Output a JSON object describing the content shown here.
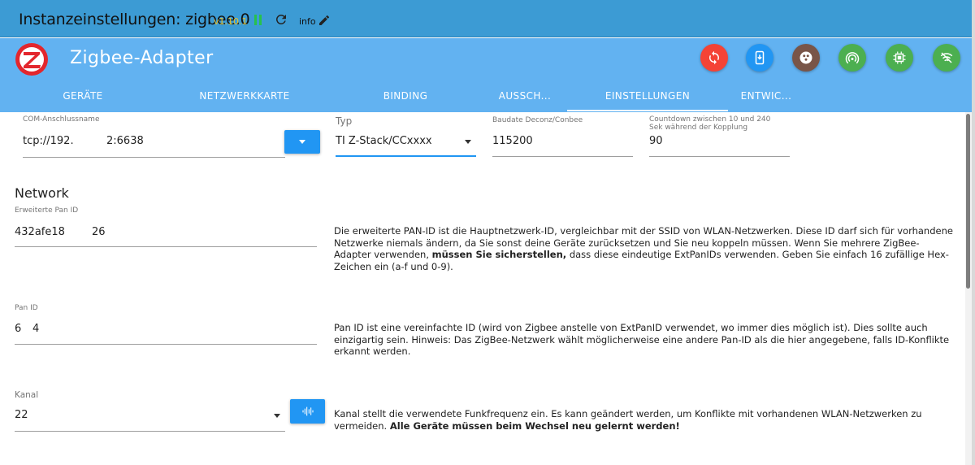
{
  "titlebar": {
    "title": "Instanzeinstellungen: zigbee.0",
    "version": "v1.10.1",
    "loglevel": "info",
    "colors": {
      "background": "#3c9bd4",
      "version": "#e6c12a",
      "running": "#27c24c"
    }
  },
  "header": {
    "adapter_title": "Zigbee-Adapter",
    "logo_icon": "zigbee-logo",
    "buttons": [
      {
        "name": "reset-button",
        "icon": "sync-icon",
        "color": "#f44336"
      },
      {
        "name": "backup-button",
        "icon": "download-icon",
        "color": "#2196f3"
      },
      {
        "name": "debug-button",
        "icon": "cookie-icon",
        "color": "#795548"
      },
      {
        "name": "join-button",
        "icon": "broadcast-icon",
        "color": "#4caf50"
      },
      {
        "name": "scan-button",
        "icon": "chip-icon",
        "color": "#4caf50"
      },
      {
        "name": "signal-button",
        "icon": "wifi-off-icon",
        "color": "#4caf50"
      }
    ],
    "tabs": [
      {
        "label": "GERÄTE",
        "active": false
      },
      {
        "label": "NETZWERKKARTE",
        "active": false
      },
      {
        "label": "BINDING",
        "active": false
      },
      {
        "label": "AUSSCH...",
        "active": false
      },
      {
        "label": "EINSTELLUNGEN",
        "active": true
      },
      {
        "label": "ENTWIC...",
        "active": false
      }
    ]
  },
  "settings": {
    "com_port": {
      "label": "COM-Anschlussname",
      "value_start": "tcp://192.",
      "value_end": "2:6638"
    },
    "type": {
      "label": "Typ",
      "value": "TI Z-Stack/CCxxxx"
    },
    "baudrate": {
      "label": "Baudate Deconz/Conbee",
      "value": "115200"
    },
    "countdown": {
      "label_line1": "Countdown zwischen 10 und 240",
      "label_line2": "Sek während der Kopplung",
      "value": "90"
    }
  },
  "network": {
    "title": "Network",
    "ext_pan_id": {
      "label": "Erweiterte Pan ID",
      "value_start": "432afe18",
      "value_end": "26",
      "desc_before": "Die erweiterte PAN-ID ist die Hauptnetzwerk-ID, vergleichbar mit der SSID von WLAN-Netzwerken. Diese ID darf sich für vorhandene Netzwerke niemals ändern, da Sie sonst deine Geräte zurücksetzen und Sie neu koppeln müssen. Wenn Sie mehrere ZigBee-Adapter verwenden, ",
      "desc_bold": "müssen Sie sicherstellen,",
      "desc_after": " dass diese eindeutige ExtPanIDs verwenden. Geben Sie einfach 16 zufällige Hex-Zeichen ein (a-f und 0-9)."
    },
    "pan_id": {
      "label": "Pan ID",
      "value_start": "6",
      "value_end": "4",
      "desc": "Pan ID ist eine vereinfachte ID (wird von Zigbee anstelle von ExtPanID verwendet, wo immer dies möglich ist). Dies sollte auch einzigartig sein. Hinweis: Das ZigBee-Netzwerk wählt möglicherweise eine andere Pan-ID als die hier angegebene, falls ID-Konflikte erkannt werden."
    },
    "channel": {
      "label": "Kanal",
      "value": "22",
      "desc_before": "Kanal stellt die verwendete Funkfrequenz ein. Es kann geändert werden, um Konflikte mit vorhandenen WLAN-Netzwerken zu vermeiden. ",
      "desc_bold": "Alle Geräte müssen beim Wechsel neu gelernt werden!"
    }
  },
  "colors": {
    "header": "#62b2f1",
    "primary_button": "#2196f3",
    "active_select_underline": "#2196f3"
  }
}
